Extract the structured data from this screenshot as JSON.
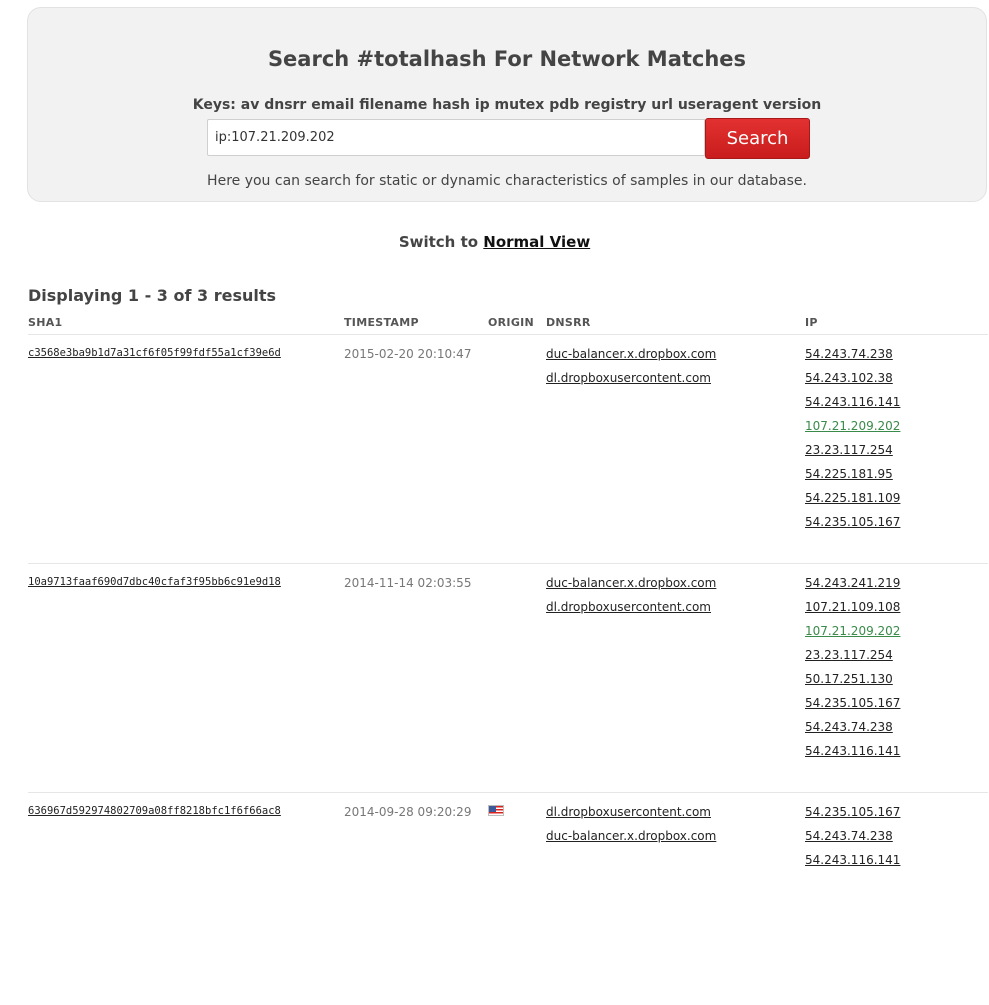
{
  "search": {
    "title": "Search #totalhash For Network Matches",
    "keys_line": "Keys: av dnsrr email filename hash ip mutex pdb registry url useragent version",
    "input_value": "ip:107.21.209.202",
    "button_label": "Search",
    "help_text": "Here you can search for static or dynamic characteristics of samples in our database."
  },
  "switch_view": {
    "prefix": "Switch to",
    "link_label": "Normal View"
  },
  "results": {
    "heading": "Displaying 1 - 3 of 3 results",
    "columns": {
      "sha1": "SHA1",
      "timestamp": "TIMESTAMP",
      "origin": "ORIGIN",
      "dnsrr": "DNSRR",
      "ip": "IP"
    },
    "highlight_ip": "107.21.209.202",
    "highlight_color": "#3a8a4a",
    "rows": [
      {
        "sha1": "c3568e3ba9b1d7a31cf6f05f99fdf55a1cf39e6d",
        "timestamp": "2015-02-20 20:10:47",
        "origin_flag": "",
        "dnsrr": [
          "duc-balancer.x.dropbox.com",
          "dl.dropboxusercontent.com"
        ],
        "ips": [
          "54.243.74.238",
          "54.243.102.38",
          "54.243.116.141",
          "107.21.209.202",
          "23.23.117.254",
          "54.225.181.95",
          "54.225.181.109",
          "54.235.105.167"
        ]
      },
      {
        "sha1": "10a9713faaf690d7dbc40cfaf3f95bb6c91e9d18",
        "timestamp": "2014-11-14 02:03:55",
        "origin_flag": "",
        "dnsrr": [
          "duc-balancer.x.dropbox.com",
          "dl.dropboxusercontent.com"
        ],
        "ips": [
          "54.243.241.219",
          "107.21.109.108",
          "107.21.209.202",
          "23.23.117.254",
          "50.17.251.130",
          "54.235.105.167",
          "54.243.74.238",
          "54.243.116.141"
        ]
      },
      {
        "sha1": "636967d592974802709a08ff8218bfc1f6f66ac8",
        "timestamp": "2014-09-28 09:20:29",
        "origin_flag": "us-flag-icon",
        "dnsrr": [
          "dl.dropboxusercontent.com",
          "duc-balancer.x.dropbox.com"
        ],
        "ips": [
          "54.235.105.167",
          "54.243.74.238",
          "54.243.116.141"
        ]
      }
    ]
  }
}
